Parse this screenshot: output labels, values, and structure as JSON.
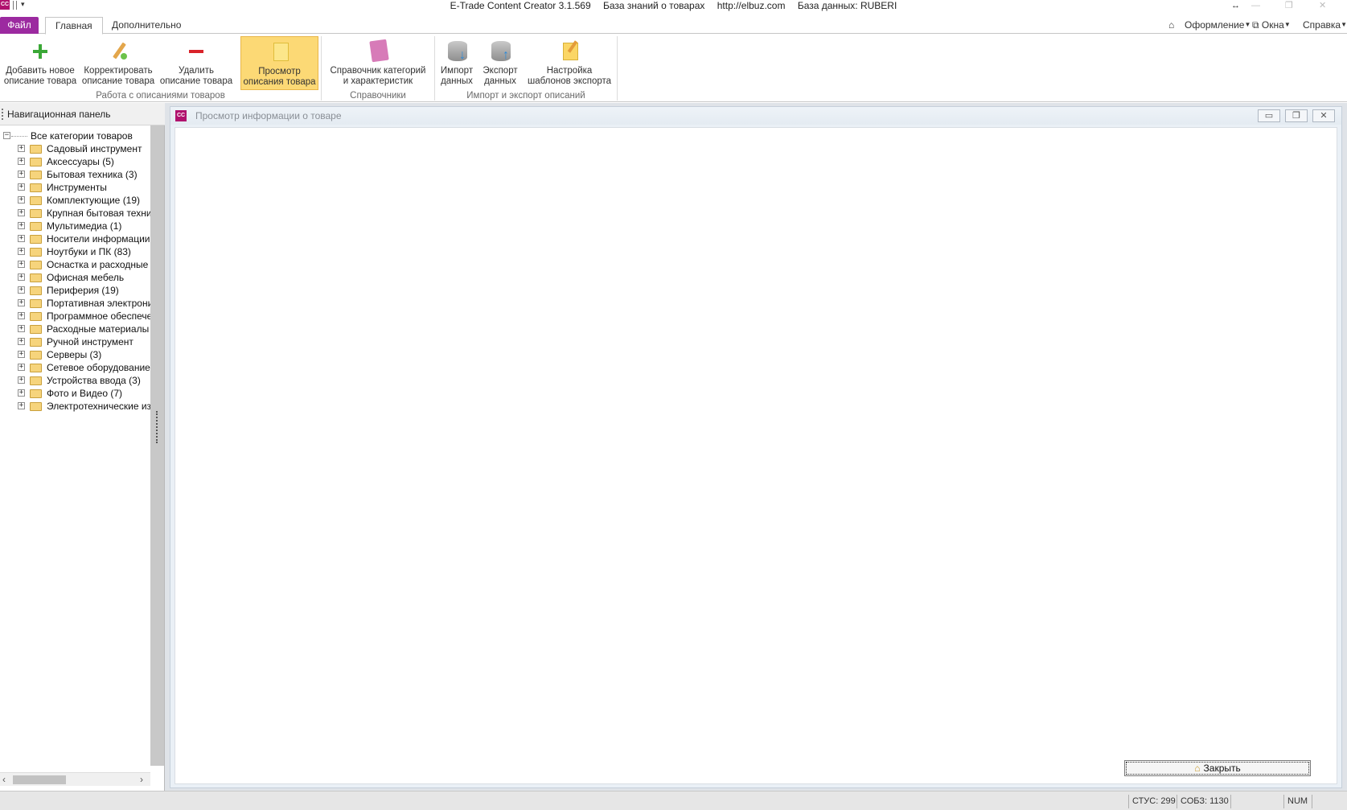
{
  "titlebar": {
    "app": "E-Trade Content Creator 3.1.569",
    "kb": "База знаний о товарах",
    "url": "http://elbuz.com",
    "db": "База данных: RUBERI",
    "logo": "CC"
  },
  "tabs": {
    "file": "Файл",
    "home": "Главная",
    "extra": "Дополнительно"
  },
  "right_menu": {
    "style": "Оформление",
    "windows": "Окна",
    "help": "Справка"
  },
  "ribbon": {
    "add_l1": "Добавить новое",
    "add_l2": "описание товара",
    "edit_l1": "Корректировать",
    "edit_l2": "описание товара",
    "delete_l1": "Удалить",
    "delete_l2": "описание товара",
    "view_l1": "Просмотр",
    "view_l2": "описания товара",
    "ref_l1": "Справочник категорий",
    "ref_l2": "и характеристик",
    "import_l1": "Импорт",
    "import_l2": "данных",
    "export_l1": "Экспорт",
    "export_l2": "данных",
    "tmpl_l1": "Настройка",
    "tmpl_l2": "шаблонов экспорта",
    "group_work": "Работа с описаниями товаров",
    "group_ref": "Справочники",
    "group_io": "Импорт и экспорт описаний"
  },
  "nav": {
    "title": "Навигационная панель",
    "root": "Все категории товаров",
    "items": [
      "Садовый инструмент",
      "Аксессуары (5)",
      "Бытовая техника (3)",
      "Инструменты",
      "Комплектующие (19)",
      "Крупная бытовая техника",
      "Мультимедиа (1)",
      "Носители информации",
      "Ноутбуки и ПК (83)",
      "Оснастка и расходные",
      "Офисная мебель",
      "Периферия (19)",
      "Портативная электроника",
      "Программное обеспечение",
      "Расходные материалы",
      "Ручной инструмент",
      "Серверы (3)",
      "Сетевое оборудование",
      "Устройства ввода (3)",
      "Фото и Видео (7)",
      "Электротехнические изделия"
    ]
  },
  "mdi": {
    "logo": "CC",
    "title": "Просмотр информации о товаре",
    "close": "Закрыть"
  },
  "status": {
    "stus": "СТУС: 299",
    "sobz": "СОБЗ: 1130",
    "num": "NUM"
  },
  "colors": {
    "file_tab": "#9c2aa0",
    "active_button": "#fcd975",
    "brand": "#b0126e"
  }
}
